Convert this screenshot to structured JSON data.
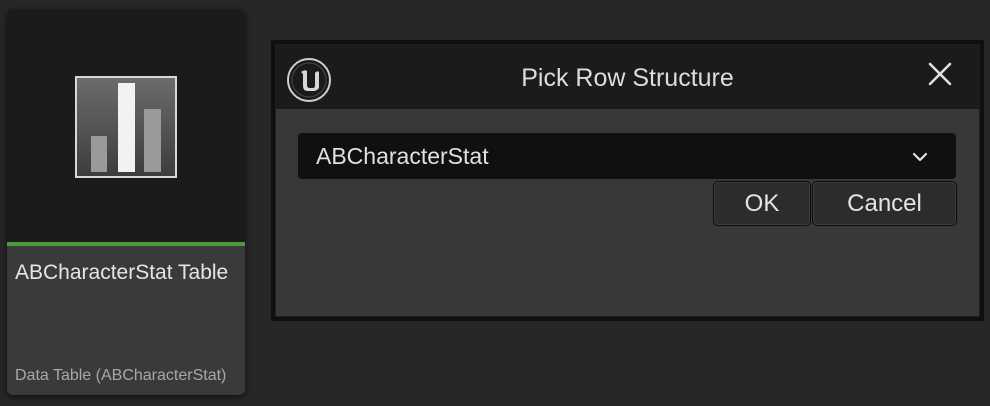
{
  "asset": {
    "name": "ABCharacterStat Table",
    "type_label": "Data Table (ABCharacterStat)",
    "icon": "data-table-bar-chart-icon",
    "accent_color": "#4d9a3b"
  },
  "dialog": {
    "title": "Pick Row Structure",
    "logo_icon": "unreal-engine-logo-icon",
    "close_icon": "close-icon",
    "row_structure": {
      "selected": "ABCharacterStat",
      "arrow_icon": "chevron-down-icon"
    },
    "buttons": {
      "ok_label": "OK",
      "cancel_label": "Cancel"
    }
  }
}
